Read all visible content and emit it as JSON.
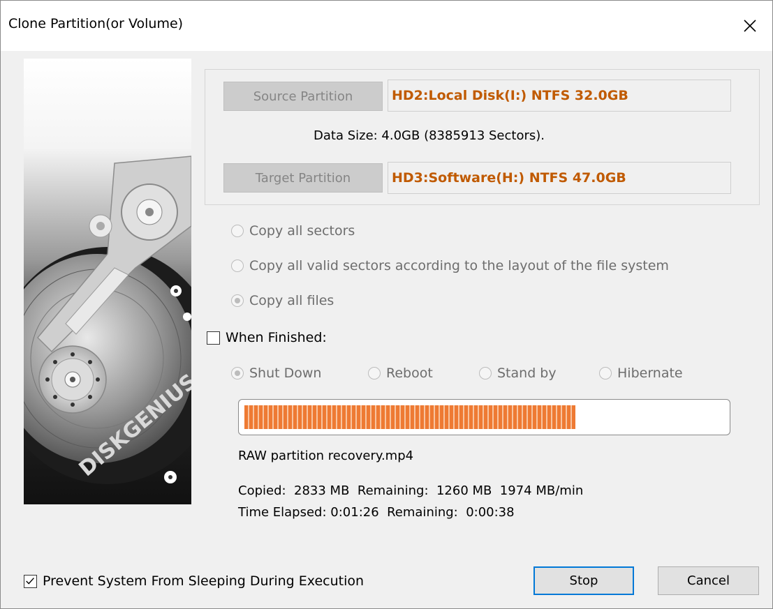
{
  "window": {
    "title": "Clone Partition(or Volume)"
  },
  "branding": {
    "logo_text": "DISKGENIUS"
  },
  "source": {
    "button_label": "Source Partition",
    "value": "HD2:Local Disk(I:) NTFS 32.0GB"
  },
  "data_size": "Data Size: 4.0GB (8385913 Sectors).",
  "target": {
    "button_label": "Target Partition",
    "value": "HD3:Software(H:) NTFS 47.0GB"
  },
  "copy_options": [
    {
      "label": "Copy all sectors",
      "checked": false
    },
    {
      "label": "Copy all valid sectors according to the layout of the file system",
      "checked": false
    },
    {
      "label": "Copy all files",
      "checked": true
    }
  ],
  "when_finished": {
    "label": "When Finished:",
    "checked": false
  },
  "finish_options": [
    {
      "label": "Shut Down",
      "checked": true
    },
    {
      "label": "Reboot",
      "checked": false
    },
    {
      "label": "Stand by",
      "checked": false
    },
    {
      "label": "Hibernate",
      "checked": false
    }
  ],
  "progress": {
    "fraction": 0.69,
    "color": "#ee7a33"
  },
  "current_file": "RAW partition recovery.mp4",
  "stats": {
    "line1": "Copied:  2833 MB  Remaining:  1260 MB  1974 MB/min",
    "line2": "Time Elapsed: 0:01:26  Remaining:  0:00:38"
  },
  "prevent_sleep": {
    "label": "Prevent System From Sleeping During Execution",
    "checked": true
  },
  "buttons": {
    "stop": "Stop",
    "cancel": "Cancel"
  }
}
